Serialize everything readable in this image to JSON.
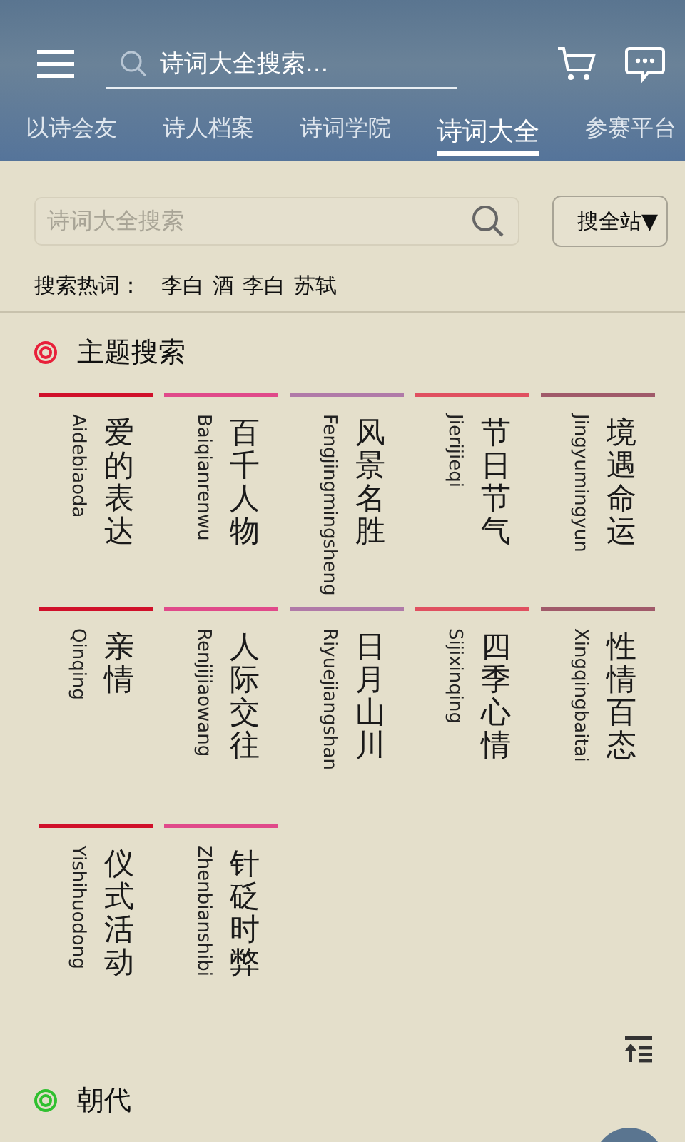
{
  "header": {
    "search_placeholder": "诗词大全搜索..."
  },
  "tabs": [
    {
      "label": "以诗会友",
      "selected": false
    },
    {
      "label": "诗人档案",
      "selected": false
    },
    {
      "label": "诗词学院",
      "selected": false
    },
    {
      "label": "诗词大全",
      "selected": true
    },
    {
      "label": "参赛平台",
      "selected": false
    }
  ],
  "search": {
    "placeholder": "诗词大全搜索",
    "scope": "搜全站▼"
  },
  "hot_words": {
    "label": "搜索热词：",
    "words": [
      "李白",
      "酒",
      "李白",
      "苏轼"
    ]
  },
  "sections": [
    {
      "title": "主题搜索",
      "color": "#e8203a",
      "topics": [
        {
          "name": "爱的表达",
          "pinyin": "Aidebiaoda",
          "color": "#d0102a"
        },
        {
          "name": "百千人物",
          "pinyin": "Baiqianrenwu",
          "color": "#e04a8a"
        },
        {
          "name": "风景名胜",
          "pinyin": "Fengjingmingsheng",
          "color": "#b07aa8"
        },
        {
          "name": "节日节气",
          "pinyin": "Jierijieqi",
          "color": "#e05060"
        },
        {
          "name": "境遇命运",
          "pinyin": "Jingyumingyun",
          "color": "#a05a6a"
        },
        {
          "name": "亲情",
          "pinyin": "Qinqing",
          "color": "#d0102a"
        },
        {
          "name": "人际交往",
          "pinyin": "Renjijiaowang",
          "color": "#e04a8a"
        },
        {
          "name": "日月山川",
          "pinyin": "Riyuejiangshan",
          "color": "#b07aa8"
        },
        {
          "name": "四季心情",
          "pinyin": "Sijixinqing",
          "color": "#e05060"
        },
        {
          "name": "性情百态",
          "pinyin": "Xingqingbaitai",
          "color": "#a05a6a"
        },
        {
          "name": "仪式活动",
          "pinyin": "Yishihuodong",
          "color": "#d0102a"
        },
        {
          "name": "针砭时弊",
          "pinyin": "Zhenbianshibi",
          "color": "#e04a8a"
        }
      ]
    },
    {
      "title": "朝代",
      "color": "#30c030"
    }
  ]
}
